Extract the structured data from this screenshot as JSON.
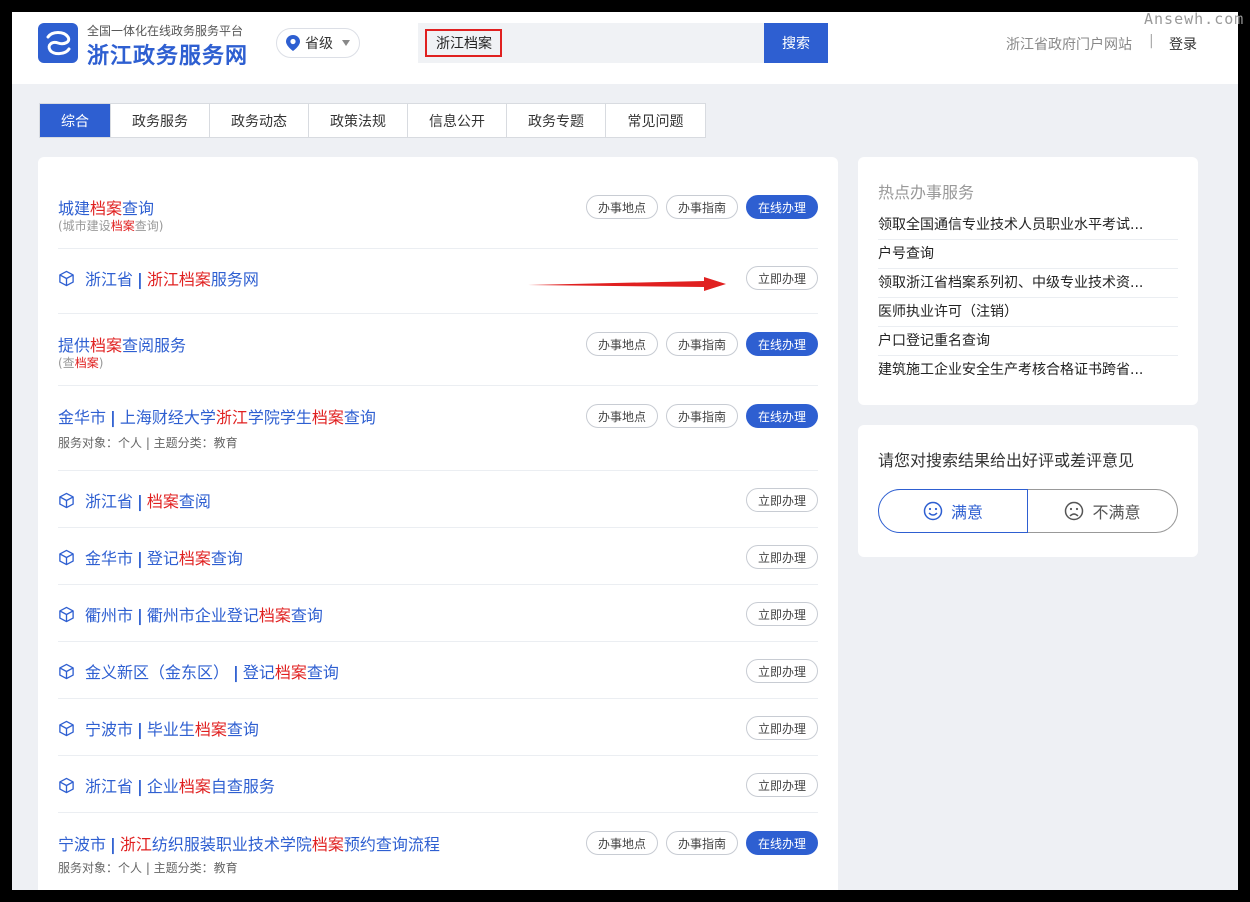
{
  "watermark": "Ansewh.com",
  "header": {
    "site_subtitle": "全国一体化在线政务服务平台",
    "site_title": "浙江政务服务网",
    "region": "省级",
    "search_value": "浙江档案",
    "search_button": "搜索",
    "portal_link": "浙江省政府门户网站",
    "separator": "|",
    "login": "登录"
  },
  "tabs": [
    "综合",
    "政务服务",
    "政务动态",
    "政策法规",
    "信息公开",
    "政务专题",
    "常见问题"
  ],
  "buttons": {
    "location": "办事地点",
    "guide": "办事指南",
    "online": "在线办理",
    "now": "立即办理"
  },
  "results": [
    {
      "type": "full",
      "title": [
        [
          "城建",
          false
        ],
        [
          "档案",
          true
        ],
        [
          "查询",
          false
        ]
      ],
      "sub": [
        [
          "(城市建设",
          false
        ],
        [
          "档案",
          true
        ],
        [
          "查询)",
          false
        ]
      ]
    },
    {
      "type": "quick",
      "region": "浙江省",
      "title": [
        [
          "浙江档案",
          true
        ],
        [
          "服务网",
          false
        ]
      ]
    },
    {
      "type": "full",
      "title": [
        [
          "提供",
          false
        ],
        [
          "档案",
          true
        ],
        [
          "查阅服务",
          false
        ]
      ],
      "sub": [
        [
          "(查",
          false
        ],
        [
          "档案",
          true
        ],
        [
          ")",
          false
        ]
      ]
    },
    {
      "type": "full",
      "region": "金华市",
      "title": [
        [
          "上海财经大学",
          false
        ],
        [
          "浙江",
          true
        ],
        [
          "学院学生",
          false
        ],
        [
          "档案",
          true
        ],
        [
          "查询",
          false
        ]
      ],
      "meta": "服务对象：个人  |  主题分类：教育"
    },
    {
      "type": "quick",
      "region": "浙江省",
      "title": [
        [
          "档案",
          true
        ],
        [
          "查阅",
          false
        ]
      ]
    },
    {
      "type": "quick",
      "region": "金华市",
      "title": [
        [
          "登记",
          false
        ],
        [
          "档案",
          true
        ],
        [
          "查询",
          false
        ]
      ]
    },
    {
      "type": "quick",
      "region": "衢州市",
      "title": [
        [
          "衢州市企业登记",
          false
        ],
        [
          "档案",
          true
        ],
        [
          "查询",
          false
        ]
      ]
    },
    {
      "type": "quick",
      "region": "金义新区（金东区）",
      "title": [
        [
          "登记",
          false
        ],
        [
          "档案",
          true
        ],
        [
          "查询",
          false
        ]
      ]
    },
    {
      "type": "quick",
      "region": "宁波市",
      "title": [
        [
          "毕业生",
          false
        ],
        [
          "档案",
          true
        ],
        [
          "查询",
          false
        ]
      ]
    },
    {
      "type": "quick",
      "region": "浙江省",
      "title": [
        [
          "企业",
          false
        ],
        [
          "档案",
          true
        ],
        [
          "自查服务",
          false
        ]
      ]
    },
    {
      "type": "full",
      "region": "宁波市",
      "title": [
        [
          "浙江",
          true
        ],
        [
          "纺织服装职业技术学院",
          false
        ],
        [
          "档案",
          true
        ],
        [
          "预约查询流程",
          false
        ]
      ],
      "meta": "服务对象：个人  |  主题分类：教育"
    }
  ],
  "hot": {
    "heading": "热点办事服务",
    "items": [
      "领取全国通信专业技术人员职业水平考试...",
      "户号查询",
      "领取浙江省档案系列初、中级专业技术资...",
      "医师执业许可（注销）",
      "户口登记重名查询",
      "建筑施工企业安全生产考核合格证书跨省..."
    ]
  },
  "feedback": {
    "heading": "请您对搜索结果给出好评或差评意见",
    "good": "满意",
    "bad": "不满意"
  },
  "colors": {
    "primary": "#2e5fd1",
    "highlight": "#e02020",
    "arrow": "#e02020"
  }
}
